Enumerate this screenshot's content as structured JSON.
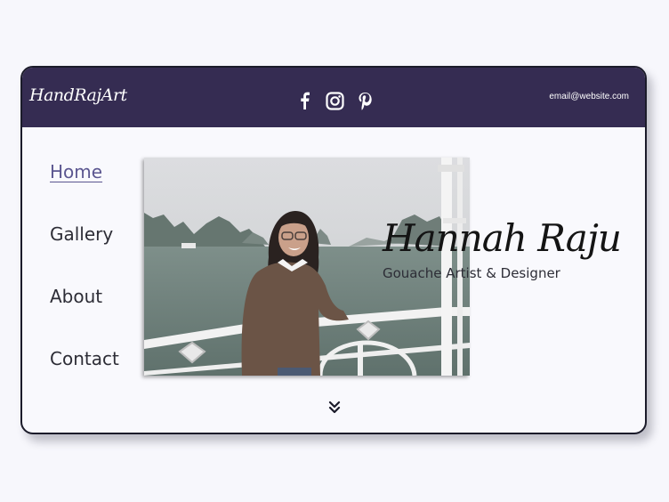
{
  "header": {
    "logo_text": "HandRajArt",
    "email": "email@website.com",
    "socials": [
      {
        "icon": "facebook-icon"
      },
      {
        "icon": "instagram-icon"
      },
      {
        "icon": "pinterest-icon"
      }
    ]
  },
  "nav": {
    "items": [
      {
        "label": "Home",
        "active": true
      },
      {
        "label": "Gallery",
        "active": false
      },
      {
        "label": "About",
        "active": false
      },
      {
        "label": "Contact",
        "active": false
      }
    ]
  },
  "hero": {
    "name": "Hannah Raju",
    "subtitle": "Gouache Artist & Designer"
  },
  "scroll": {
    "icon": "double-chevron-down-icon"
  },
  "colors": {
    "header_bg": "#352c52",
    "page_bg": "#f7f7fc",
    "active_link": "#5b5690",
    "text": "#2d2d36"
  }
}
